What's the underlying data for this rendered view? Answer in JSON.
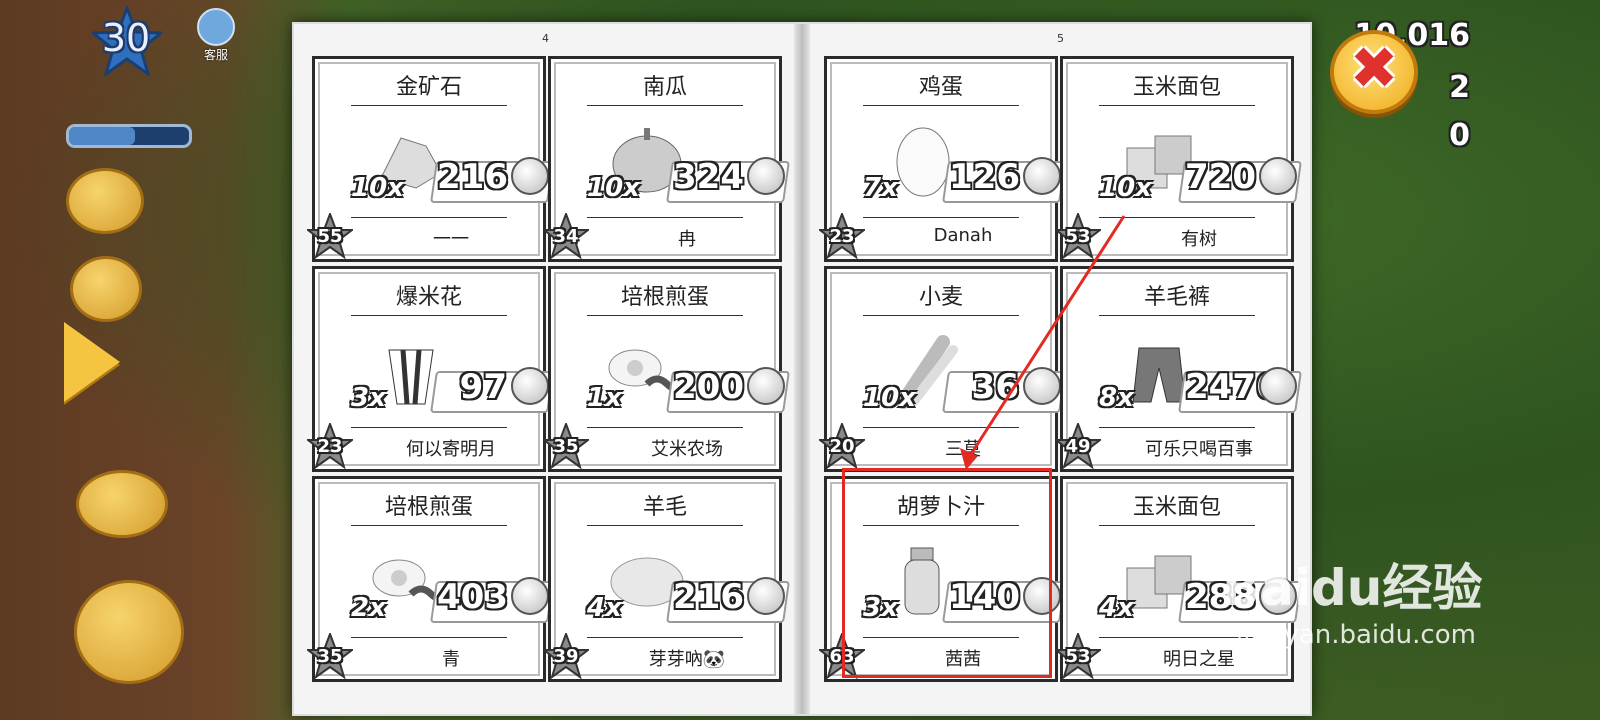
{
  "hud": {
    "level": "30",
    "service_label": "客服",
    "coins": "10,016",
    "diamonds": "2",
    "vouchers": "0",
    "close_symbol": "✖"
  },
  "book": {
    "left_page_number": "4",
    "right_page_number": "5",
    "cards": [
      {
        "title": "金矿石",
        "qty": "10x",
        "price": "216",
        "level": "55",
        "seller": "一一",
        "icon": "gold-ore-icon"
      },
      {
        "title": "南瓜",
        "qty": "10x",
        "price": "324",
        "level": "34",
        "seller": "冉",
        "icon": "pumpkin-icon"
      },
      {
        "title": "爆米花",
        "qty": "3x",
        "price": "97",
        "level": "23",
        "seller": "何以寄明月",
        "icon": "popcorn-icon"
      },
      {
        "title": "培根煎蛋",
        "qty": "1x",
        "price": "200",
        "level": "35",
        "seller": "艾米农场",
        "icon": "bacon-eggs-icon"
      },
      {
        "title": "培根煎蛋",
        "qty": "2x",
        "price": "403",
        "level": "35",
        "seller": "青",
        "icon": "bacon-eggs-icon"
      },
      {
        "title": "羊毛",
        "qty": "4x",
        "price": "216",
        "level": "39",
        "seller": "芽芽吶🐼",
        "icon": "wool-icon"
      },
      {
        "title": "鸡蛋",
        "qty": "7x",
        "price": "126",
        "level": "23",
        "seller": "Danah",
        "icon": "egg-icon"
      },
      {
        "title": "玉米面包",
        "qty": "10x",
        "price": "720",
        "level": "53",
        "seller": "有树",
        "icon": "cornbread-icon"
      },
      {
        "title": "小麦",
        "qty": "10x",
        "price": "36",
        "level": "20",
        "seller": "三莫",
        "icon": "wheat-icon"
      },
      {
        "title": "羊毛裤",
        "qty": "8x",
        "price": "2476",
        "level": "49",
        "seller": "可乐只喝百事",
        "icon": "wool-pants-icon"
      },
      {
        "title": "胡萝卜汁",
        "qty": "3x",
        "price": "140",
        "level": "63",
        "seller": "茜茜",
        "icon": "carrot-juice-icon"
      },
      {
        "title": "玉米面包",
        "qty": "4x",
        "price": "288",
        "level": "53",
        "seller": "明日之星",
        "icon": "cornbread-icon"
      }
    ]
  },
  "watermark": {
    "brand": "Baidu经验",
    "url": "jingyan.baidu.com"
  },
  "colors": {
    "highlight": "#e32a22",
    "coin": "#f0b429",
    "star": "#8a8a8a"
  }
}
